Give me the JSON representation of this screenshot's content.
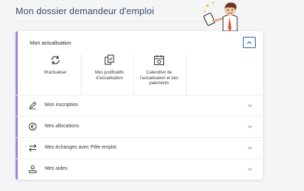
{
  "page": {
    "title": "Mon dossier demandeur d'emploi"
  },
  "actualisation": {
    "title": "Mon actualisation",
    "expanded": true,
    "accent_color": "#a77ee0",
    "tiles": [
      {
        "label": "M'actualiser",
        "icon": "refresh-icon"
      },
      {
        "label": "Mes justificatifs d'actualisation",
        "icon": "documents-icon"
      },
      {
        "label": "Calendrier de l'actualisation et des paiements",
        "icon": "calendar-icon"
      }
    ]
  },
  "sections": [
    {
      "label": "Mon inscription",
      "icon": "pen-icon"
    },
    {
      "label": "Mes allocations",
      "icon": "euro-icon"
    },
    {
      "label": "Mes échanges avec Pôle emploi",
      "icon": "exchange-arrows-icon"
    },
    {
      "label": "Mes aides",
      "icon": "helping-hands-icon"
    }
  ],
  "colors": {
    "focus_border": "#1f56a6",
    "title_text": "#3a4a6b"
  }
}
